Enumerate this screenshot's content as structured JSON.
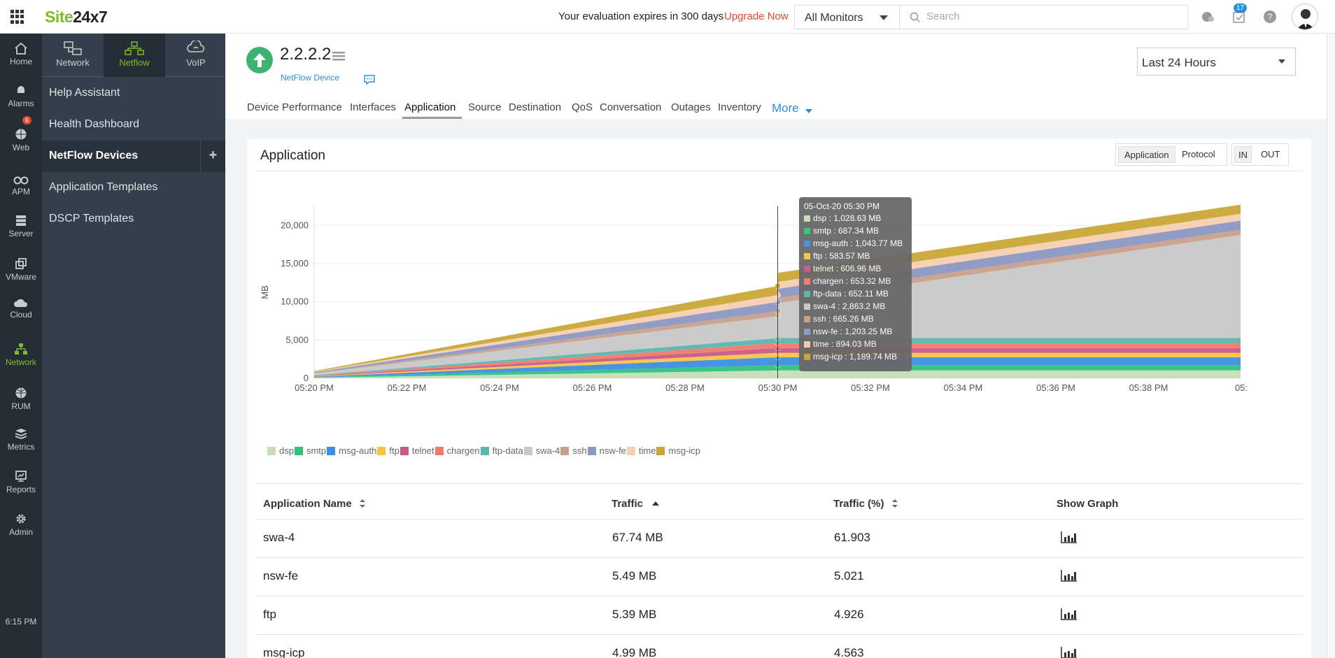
{
  "topbar": {
    "logo_site": "Site",
    "logo_brand": "24x7",
    "eval_text": "Your evaluation expires in 300 days",
    "upgrade_label": "Upgrade Now",
    "monitor_filter": "All Monitors",
    "search_placeholder": "Search",
    "notification_count": "17"
  },
  "leftnav": {
    "items": [
      {
        "label": "Home",
        "icon": "home-icon"
      },
      {
        "label": "Alarms",
        "icon": "bell-icon"
      },
      {
        "label": "Web",
        "icon": "globe-icon"
      },
      {
        "label": "APM",
        "icon": "binoculars-icon"
      },
      {
        "label": "Server",
        "icon": "server-icon"
      },
      {
        "label": "VMware",
        "icon": "vmware-icon"
      },
      {
        "label": "Cloud",
        "icon": "cloud-icon"
      },
      {
        "label": "Network",
        "icon": "network-icon"
      },
      {
        "label": "RUM",
        "icon": "rum-globe-icon"
      },
      {
        "label": "Metrics",
        "icon": "layers-icon"
      },
      {
        "label": "Reports",
        "icon": "reports-icon"
      },
      {
        "label": "Admin",
        "icon": "gear-icon"
      }
    ],
    "alarm_count": "6",
    "clock": "6:15 PM"
  },
  "subsidebar": {
    "tabs": [
      {
        "label": "Network"
      },
      {
        "label": "Netflow"
      },
      {
        "label": "VoIP"
      }
    ],
    "items": [
      {
        "label": "Help Assistant"
      },
      {
        "label": "Health Dashboard"
      },
      {
        "label": "NetFlow Devices"
      },
      {
        "label": "Application Templates"
      },
      {
        "label": "DSCP Templates"
      }
    ]
  },
  "monitor": {
    "name": "2.2.2.2",
    "type": "NetFlow Device",
    "status": "up"
  },
  "time_range": "Last 24 Hours",
  "tabs": [
    "Device Performance",
    "Interfaces",
    "Application",
    "Source",
    "Destination",
    "QoS",
    "Conversation",
    "Outages",
    "Inventory"
  ],
  "more_label": "More",
  "panel": {
    "title": "Application",
    "view_toggle": [
      "Application",
      "Protocol"
    ],
    "direction_toggle": [
      "IN",
      "OUT"
    ]
  },
  "chart_data": {
    "type": "area",
    "stacked": true,
    "ylabel": "MB",
    "ylim": [
      0,
      22500
    ],
    "yticks": [
      "0",
      "5,000",
      "10,000",
      "15,000",
      "20,000"
    ],
    "x_tick_labels": [
      "05:20 PM",
      "05:22 PM",
      "05:24 PM",
      "05:26 PM",
      "05:28 PM",
      "05:30 PM",
      "05:32 PM",
      "05:34 PM",
      "05:36 PM",
      "05:38 PM",
      "05:"
    ],
    "x": [
      "05:20 PM",
      "05:30 PM",
      "05:30 PM",
      "05:40 PM"
    ],
    "series": [
      {
        "name": "dsp",
        "color": "#c7dcb7",
        "values": [
          80,
          1028.63,
          1028.63,
          1028.63
        ]
      },
      {
        "name": "smtp",
        "color": "#2ec27e",
        "values": [
          60,
          687.34,
          687.34,
          687.34
        ]
      },
      {
        "name": "msg-auth",
        "color": "#3d8fe0",
        "values": [
          80,
          1043.77,
          1043.77,
          1043.77
        ]
      },
      {
        "name": "ftp",
        "color": "#f5c542",
        "values": [
          50,
          583.57,
          583.57,
          583.57
        ]
      },
      {
        "name": "telnet",
        "color": "#c85a8a",
        "values": [
          50,
          606.96,
          606.96,
          606.96
        ]
      },
      {
        "name": "chargen",
        "color": "#f07b6b",
        "values": [
          50,
          653.32,
          653.32,
          653.32
        ]
      },
      {
        "name": "ftp-data",
        "color": "#5bb5b0",
        "values": [
          50,
          652.11,
          652.11,
          652.11
        ]
      },
      {
        "name": "swa-4",
        "color": "#c8c8c8",
        "values": [
          200,
          2863.2,
          4600,
          13500
        ]
      },
      {
        "name": "ssh",
        "color": "#c9a08a",
        "values": [
          60,
          665.26,
          665.26,
          665.26
        ]
      },
      {
        "name": "nsw-fe",
        "color": "#8c98c2",
        "values": [
          100,
          1203.25,
          1203.25,
          1203.25
        ]
      },
      {
        "name": "time",
        "color": "#f5cfb0",
        "values": [
          70,
          894.03,
          894.03,
          894.03
        ]
      },
      {
        "name": "msg-icp",
        "color": "#c9a637",
        "values": [
          100,
          1189.74,
          1189.74,
          1189.74
        ]
      }
    ],
    "tooltip": {
      "date": "05-Oct-20 05:30 PM",
      "rows": [
        {
          "name": "dsp",
          "value": "1,028.63 MB"
        },
        {
          "name": "smtp",
          "value": "687.34 MB"
        },
        {
          "name": "msg-auth",
          "value": "1,043.77 MB"
        },
        {
          "name": "ftp",
          "value": "583.57 MB"
        },
        {
          "name": "telnet",
          "value": "606.96 MB"
        },
        {
          "name": "chargen",
          "value": "653.32 MB"
        },
        {
          "name": "ftp-data",
          "value": "652.11 MB"
        },
        {
          "name": "swa-4",
          "value": "2,863.2 MB"
        },
        {
          "name": "ssh",
          "value": "665.26 MB"
        },
        {
          "name": "nsw-fe",
          "value": "1,203.25 MB"
        },
        {
          "name": "time",
          "value": "894.03 MB"
        },
        {
          "name": "msg-icp",
          "value": "1,189.74 MB"
        }
      ]
    }
  },
  "table": {
    "columns": [
      "Application Name",
      "Traffic",
      "Traffic (%)",
      "Show Graph"
    ],
    "rows": [
      {
        "name": "swa-4",
        "traffic": "67.74 MB",
        "percent": "61.903"
      },
      {
        "name": "nsw-fe",
        "traffic": "5.49 MB",
        "percent": "5.021"
      },
      {
        "name": "ftp",
        "traffic": "5.39 MB",
        "percent": "4.926"
      },
      {
        "name": "msg-icp",
        "traffic": "4.99 MB",
        "percent": "4.563"
      }
    ]
  }
}
